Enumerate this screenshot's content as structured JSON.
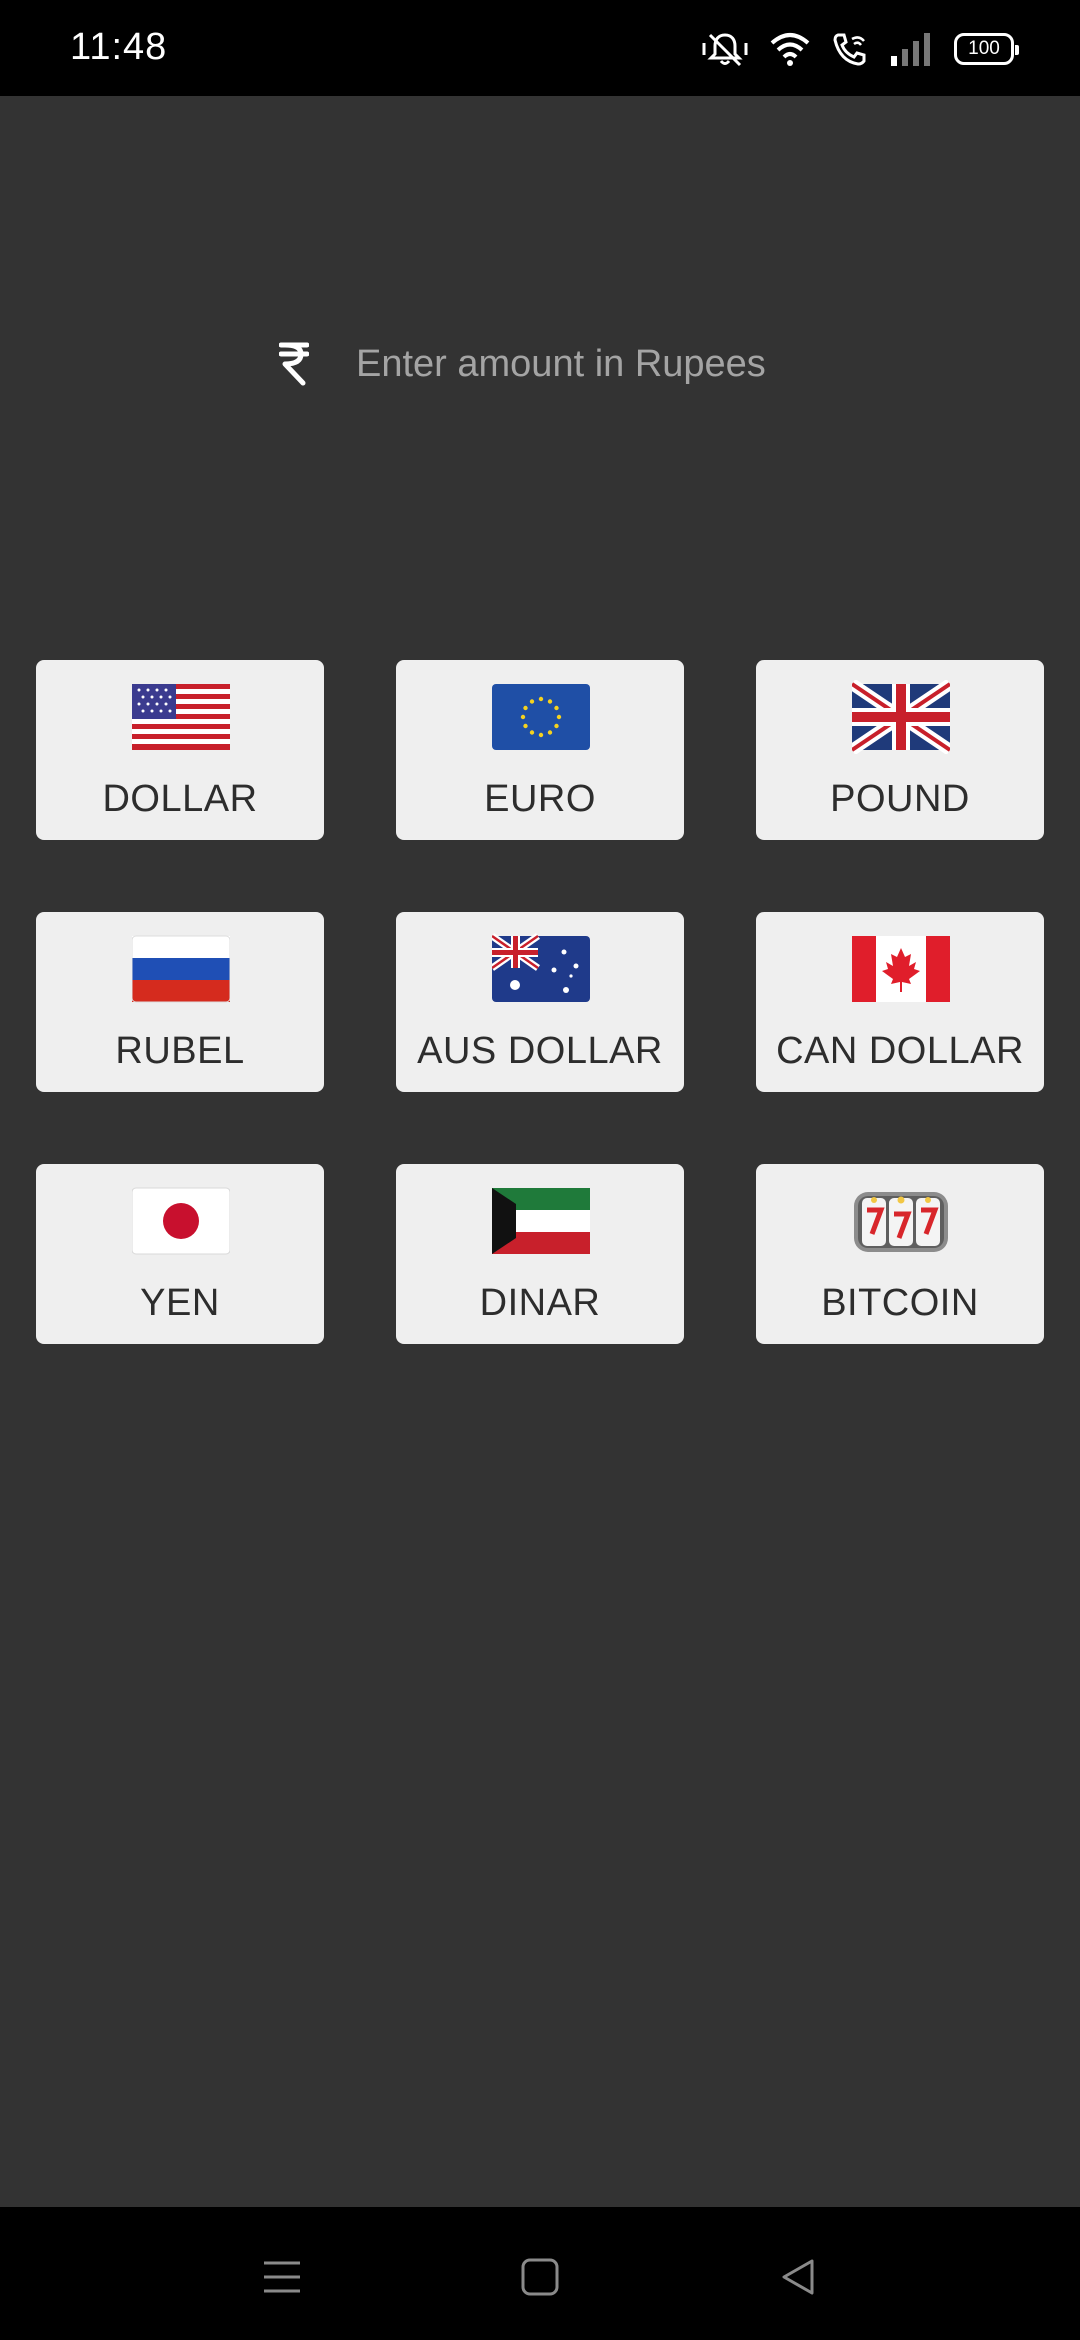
{
  "status": {
    "time": "11:48",
    "battery": "100",
    "icons": [
      "mute-icon",
      "wifi-icon",
      "wifi-calling-icon",
      "signal-icon",
      "battery-icon"
    ]
  },
  "amount": {
    "placeholder": "Enter amount in Rupees",
    "value": "",
    "icon": "rupee-icon"
  },
  "currencies": [
    {
      "label": "DOLLAR",
      "icon": "us-flag-icon"
    },
    {
      "label": "EURO",
      "icon": "eu-flag-icon"
    },
    {
      "label": "POUND",
      "icon": "uk-flag-icon"
    },
    {
      "label": "RUBEL",
      "icon": "russia-flag-icon"
    },
    {
      "label": "AUS DOLLAR",
      "icon": "australia-flag-icon"
    },
    {
      "label": "CAN DOLLAR",
      "icon": "canada-flag-icon"
    },
    {
      "label": "YEN",
      "icon": "japan-flag-icon"
    },
    {
      "label": "DINAR",
      "icon": "kuwait-flag-icon"
    },
    {
      "label": "BITCOIN",
      "icon": "slot-machine-icon"
    }
  ],
  "navigation": {
    "buttons": [
      "menu-icon",
      "home-icon",
      "back-icon"
    ]
  },
  "colors": {
    "background": "#333333",
    "card": "#efefef",
    "text": "#2d2d2d",
    "placeholder": "#a4a4a4"
  }
}
